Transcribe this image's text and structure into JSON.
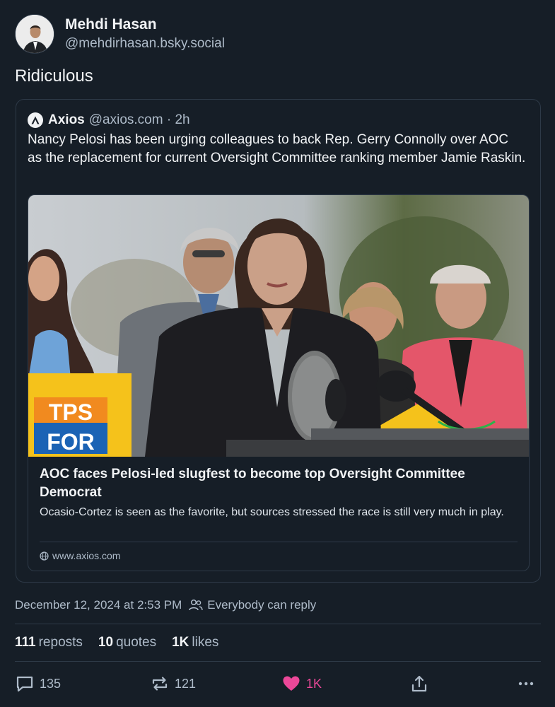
{
  "post": {
    "author_name": "Mehdi Hasan",
    "author_handle": "@mehdirhasan.bsky.social",
    "text": "Ridiculous"
  },
  "quote": {
    "author_name": "Axios",
    "handle_and_time": "@axios.com · 2h",
    "text": "Nancy Pelosi has been urging colleagues to back Rep. Gerry Connolly over AOC as the replacement for current Oversight Committee ranking member Jamie Raskin.",
    "link": {
      "title": "AOC faces Pelosi-led slugfest to become top Oversight Committee Democrat",
      "description": "Ocasio-Cortez is seen as the favorite, but sources stressed the race is still very much in play.",
      "domain": "www.axios.com",
      "sign_text_line1": "TPS",
      "sign_text_line2": "FOR"
    }
  },
  "meta": {
    "timestamp": "December 12, 2024 at 2:53 PM",
    "reply_setting": "Everybody can reply"
  },
  "stats": {
    "reposts_count": "111",
    "reposts_label": "reposts",
    "quotes_count": "10",
    "quotes_label": "quotes",
    "likes_count": "1K",
    "likes_label": "likes"
  },
  "actions": {
    "reply_count": "135",
    "repost_count": "121",
    "like_count": "1K"
  },
  "colors": {
    "background": "#161e27",
    "border": "#2e3a48",
    "muted_text": "#aebbc9",
    "like_pink": "#ec4899"
  }
}
